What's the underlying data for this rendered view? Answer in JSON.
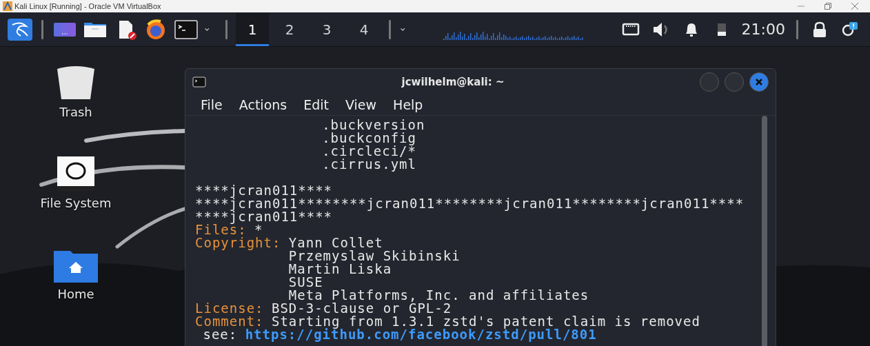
{
  "host_window": {
    "title": "Kali Linux [Running] - Oracle VM VirtualBox"
  },
  "panel": {
    "workspaces": [
      {
        "label": "1",
        "selected": true
      },
      {
        "label": "2",
        "selected": false
      },
      {
        "label": "3",
        "selected": false
      },
      {
        "label": "4",
        "selected": false
      }
    ],
    "clock": "21:00"
  },
  "desktop_icons": [
    {
      "kind": "trash",
      "label": "Trash"
    },
    {
      "kind": "drive",
      "label": "File System"
    },
    {
      "kind": "home",
      "label": "Home"
    }
  ],
  "terminal": {
    "title": "jcwilhelm@kali: ~",
    "menu": [
      "File",
      "Actions",
      "Edit",
      "View",
      "Help"
    ],
    "lines": [
      {
        "kind": "continuation",
        "text": ".buckversion"
      },
      {
        "kind": "continuation",
        "text": ".buckconfig"
      },
      {
        "kind": "continuation",
        "text": ".circleci/*"
      },
      {
        "kind": "continuation",
        "text": ".cirrus.yml"
      },
      {
        "kind": "blank"
      },
      {
        "kind": "plain",
        "text": "****jcran011****"
      },
      {
        "kind": "plain",
        "text": "****jcran011********jcran011********jcran011********jcran011****"
      },
      {
        "kind": "plain",
        "text": "****jcran011****"
      },
      {
        "kind": "field",
        "label": "Files:",
        "values": [
          "*"
        ]
      },
      {
        "kind": "field",
        "label": "Copyright:",
        "values": [
          "Yann Collet",
          "Przemyslaw Skibinski",
          "Martin Liska",
          "SUSE",
          "Meta Platforms, Inc. and affiliates"
        ]
      },
      {
        "kind": "field",
        "label": "License:",
        "values": [
          "BSD-3-clause or GPL-2"
        ]
      },
      {
        "kind": "field",
        "label": "Comment:",
        "values": [
          "Starting from 1.3.1 zstd's patent claim is removed"
        ]
      },
      {
        "kind": "see",
        "label": "see:",
        "link": "https://github.com/facebook/zstd/pull/801"
      }
    ]
  }
}
